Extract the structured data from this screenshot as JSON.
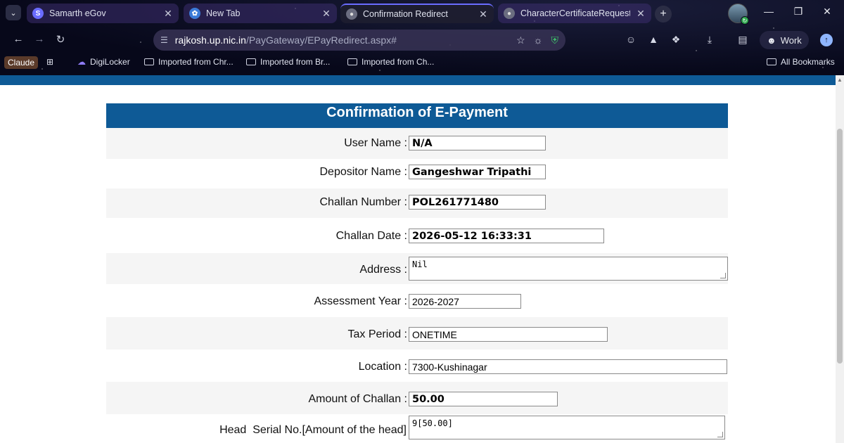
{
  "browser": {
    "tabs": [
      {
        "label": "Samarth eGov",
        "active": false
      },
      {
        "label": "New Tab",
        "active": false
      },
      {
        "label": "Confirmation Redirect",
        "active": true
      },
      {
        "label": "CharacterCertificateRequest(",
        "active": false
      }
    ],
    "url_host": "rajkosh.up.nic.in",
    "url_path": "/PayGateway/EPayRedirect.aspx#",
    "profile_label": "Work",
    "bookmarks": [
      {
        "label": "Claude",
        "icon": "claude-icon"
      },
      {
        "label": "DigiLocker",
        "icon": "cloud-icon"
      },
      {
        "label": "Imported from Chr...",
        "icon": "folder-icon"
      },
      {
        "label": "Imported from Br...",
        "icon": "folder-icon"
      },
      {
        "label": "Imported from Ch...",
        "icon": "folder-icon"
      }
    ],
    "all_bookmarks": "All Bookmarks"
  },
  "form": {
    "title": "Confirmation of E-Payment",
    "fields": [
      {
        "label": "User Name :",
        "value": "N/A"
      },
      {
        "label": "Depositor Name :",
        "value": "Gangeshwar Tripathi"
      },
      {
        "label": "Challan Number :",
        "value": "POL261771480"
      },
      {
        "label": "Challan Date :",
        "value": "2026-05-12 16:33:31"
      },
      {
        "label": "Address :",
        "value": "Nil"
      },
      {
        "label": "Assessment Year :",
        "value": "2026-2027"
      },
      {
        "label": "Tax Period :",
        "value": "ONETIME"
      },
      {
        "label": "Location :",
        "value": "7300-Kushinagar"
      },
      {
        "label": "Amount of Challan :",
        "value": "50.00"
      },
      {
        "label": "Head  Serial No.[Amount of the head]",
        "value": "9[50.00]"
      }
    ]
  },
  "colors": {
    "header_blue": "#0e5a96",
    "row_alt": "#f5f5f5"
  }
}
